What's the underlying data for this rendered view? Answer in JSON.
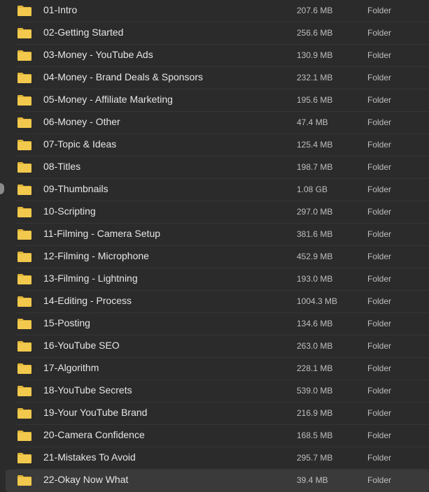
{
  "rows": [
    {
      "name": "01-Intro",
      "size": "207.6 MB",
      "kind": "Folder"
    },
    {
      "name": "02-Getting Started",
      "size": "256.6 MB",
      "kind": "Folder"
    },
    {
      "name": "03-Money - YouTube Ads",
      "size": "130.9 MB",
      "kind": "Folder"
    },
    {
      "name": "04-Money - Brand Deals & Sponsors",
      "size": "232.1 MB",
      "kind": "Folder"
    },
    {
      "name": "05-Money - Affiliate Marketing",
      "size": "195.6 MB",
      "kind": "Folder"
    },
    {
      "name": "06-Money - Other",
      "size": "47.4 MB",
      "kind": "Folder"
    },
    {
      "name": "07-Topic & Ideas",
      "size": "125.4 MB",
      "kind": "Folder"
    },
    {
      "name": "08-Titles",
      "size": "198.7 MB",
      "kind": "Folder"
    },
    {
      "name": "09-Thumbnails",
      "size": "1.08 GB",
      "kind": "Folder"
    },
    {
      "name": "10-Scripting",
      "size": "297.0 MB",
      "kind": "Folder"
    },
    {
      "name": "11-Filming - Camera Setup",
      "size": "381.6 MB",
      "kind": "Folder"
    },
    {
      "name": "12-Filming - Microphone",
      "size": "452.9 MB",
      "kind": "Folder"
    },
    {
      "name": "13-Filming - Lightning",
      "size": "193.0 MB",
      "kind": "Folder"
    },
    {
      "name": "14-Editing - Process",
      "size": "1004.3 MB",
      "kind": "Folder"
    },
    {
      "name": "15-Posting",
      "size": "134.6 MB",
      "kind": "Folder"
    },
    {
      "name": "16-YouTube SEO",
      "size": "263.0 MB",
      "kind": "Folder"
    },
    {
      "name": "17-Algorithm",
      "size": "228.1 MB",
      "kind": "Folder"
    },
    {
      "name": "18-YouTube Secrets",
      "size": "539.0 MB",
      "kind": "Folder"
    },
    {
      "name": "19-Your YouTube Brand",
      "size": "216.9 MB",
      "kind": "Folder"
    },
    {
      "name": "20-Camera Confidence",
      "size": "168.5 MB",
      "kind": "Folder"
    },
    {
      "name": "21-Mistakes To Avoid",
      "size": "295.7 MB",
      "kind": "Folder"
    },
    {
      "name": "22-Okay Now What",
      "size": "39.4 MB",
      "kind": "Folder",
      "selected": true
    }
  ],
  "icon": "folder-icon",
  "colors": {
    "background": "#2b2b2b",
    "folder": "#f2c94c",
    "folder_tab": "#e0b53a",
    "selection": "#3a3a3a"
  }
}
